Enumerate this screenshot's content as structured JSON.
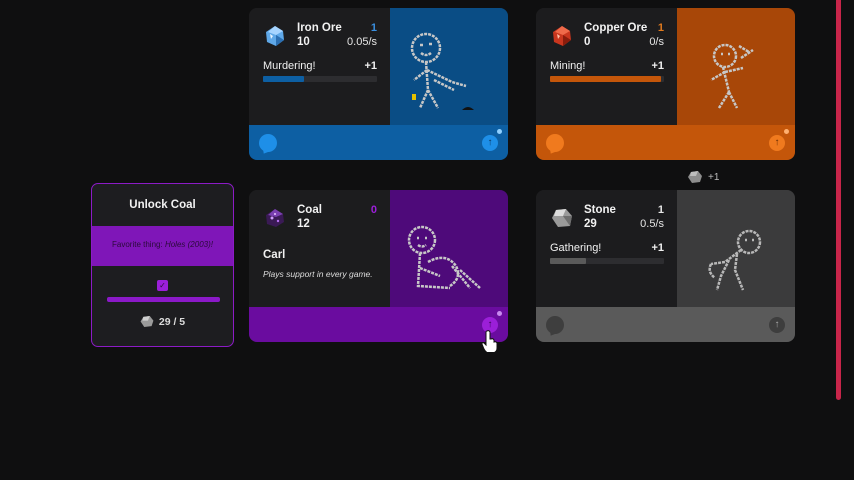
{
  "cards": {
    "iron": {
      "name": "Iron Ore",
      "count": "10",
      "level": "1",
      "rate": "0.05/s",
      "task": "Murdering!",
      "plus": "+1",
      "progress": 0.36,
      "color": "#0d5fa3",
      "icon": "iron-ore-icon"
    },
    "copper": {
      "name": "Copper Ore",
      "count": "0",
      "level": "1",
      "rate": "0/s",
      "task": "Mining!",
      "plus": "+1",
      "progress": 0.97,
      "color": "#c4560a",
      "icon": "copper-ore-icon"
    },
    "coal": {
      "name": "Coal",
      "count": "12",
      "level": "0",
      "worker": "Carl",
      "description": "Plays support in every game.",
      "color": "#6a0c9f",
      "icon": "coal-icon"
    },
    "stone": {
      "name": "Stone",
      "count": "29",
      "level": "1",
      "rate": "0.5/s",
      "task": "Gathering!",
      "plus": "+1",
      "progress": 0.32,
      "color": "#5a5a5a",
      "icon": "stone-icon"
    }
  },
  "unlock": {
    "title": "Unlock Coal",
    "favorite_label": "Favorite thing:",
    "favorite_value": "Holes (2003)!",
    "cost": "29 / 5",
    "color": "#8c1bc6"
  },
  "floating_gain": "+1"
}
